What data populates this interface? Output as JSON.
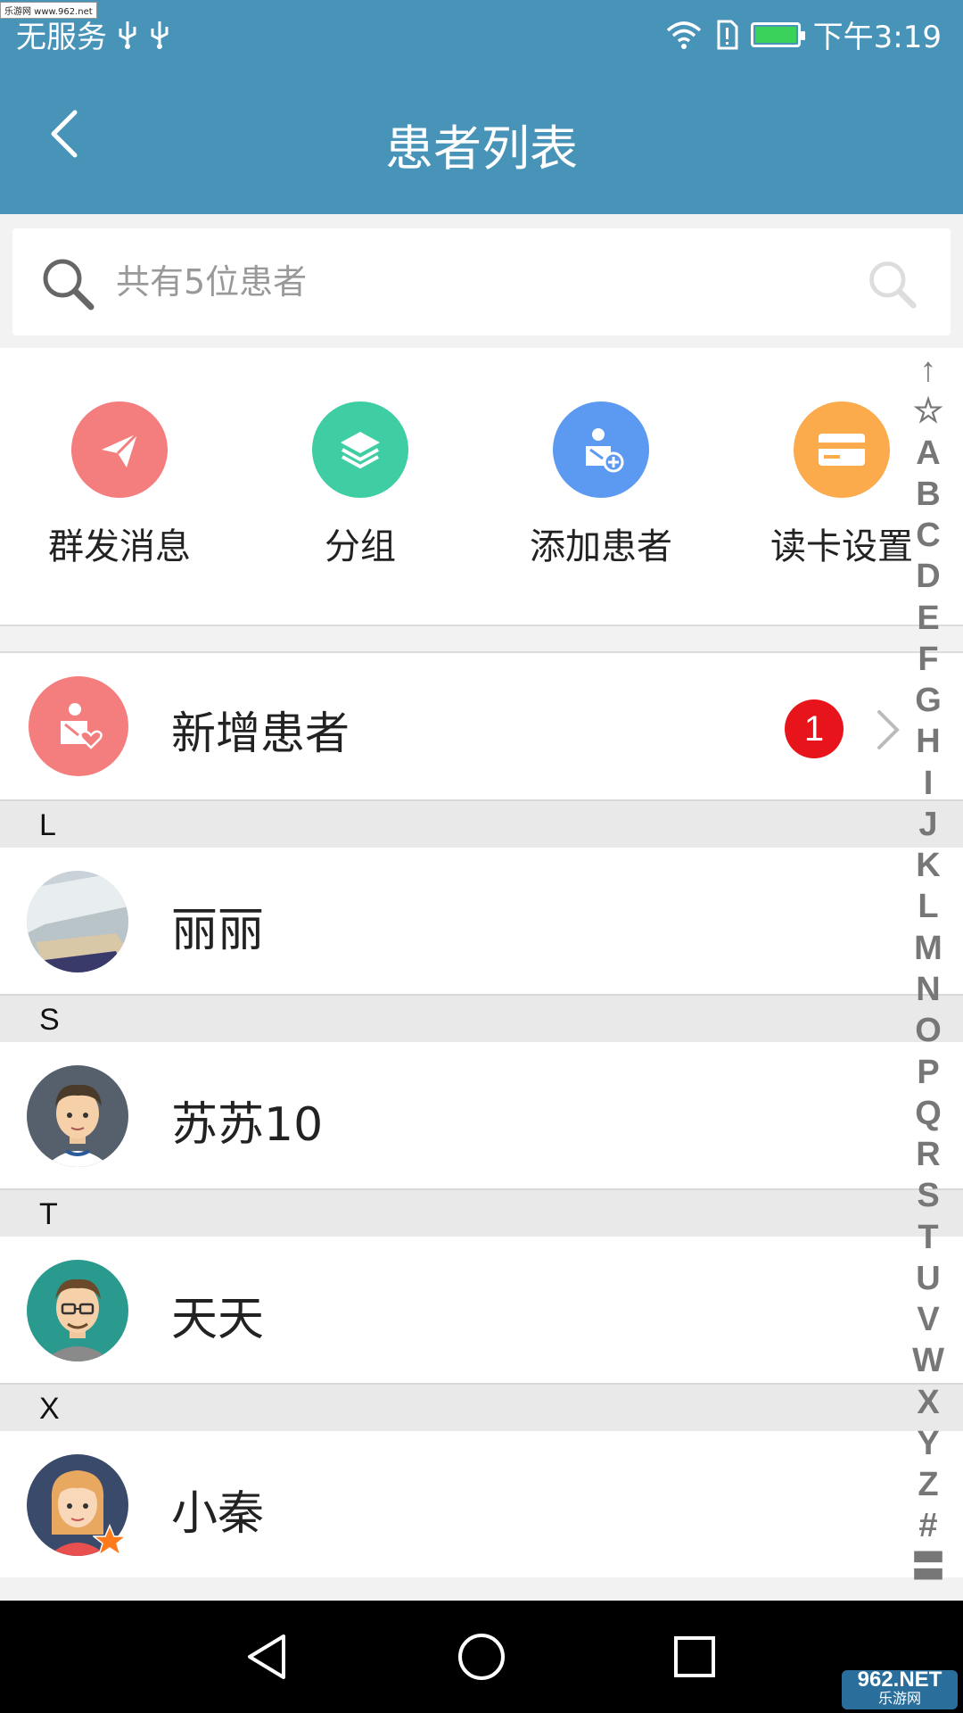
{
  "status_bar": {
    "carrier": "无服务",
    "time": "下午3:19",
    "watermark_top": "乐游网 www.962.net",
    "usb_icon_1": "usb-icon",
    "usb_icon_2": "usb-icon",
    "wifi_icon": "wifi-icon",
    "sim_icon": "sim-alert-icon",
    "battery_icon": "battery-charging-icon"
  },
  "header": {
    "title": "患者列表",
    "back_icon": "chevron-left-icon"
  },
  "search": {
    "placeholder": "共有5位患者"
  },
  "quick_actions": [
    {
      "label": "群发消息",
      "icon": "paper-plane-icon",
      "color": "#f47d7e"
    },
    {
      "label": "分组",
      "icon": "layers-icon",
      "color": "#3fcea3"
    },
    {
      "label": "添加患者",
      "icon": "add-patient-icon",
      "color": "#5b9af0"
    },
    {
      "label": "读卡设置",
      "icon": "card-icon",
      "color": "#fbab4c"
    }
  ],
  "new_patients": {
    "label": "新增患者",
    "badge": "1"
  },
  "sections": [
    {
      "letter": "L",
      "patients": [
        {
          "name": "丽丽",
          "avatar": "photo-avatar"
        }
      ]
    },
    {
      "letter": "S",
      "patients": [
        {
          "name": "苏苏10",
          "avatar": "man-avatar"
        }
      ]
    },
    {
      "letter": "T",
      "patients": [
        {
          "name": "天天",
          "avatar": "man-glasses-avatar"
        }
      ]
    },
    {
      "letter": "X",
      "patients": [
        {
          "name": "小秦",
          "avatar": "woman-avatar"
        }
      ]
    }
  ],
  "index_bar": [
    "↑",
    "☆",
    "A",
    "B",
    "C",
    "D",
    "E",
    "F",
    "G",
    "H",
    "I",
    "J",
    "K",
    "L",
    "M",
    "N",
    "O",
    "P",
    "Q",
    "R",
    "S",
    "T",
    "U",
    "V",
    "W",
    "X",
    "Y",
    "Z",
    "#",
    "〓"
  ],
  "nav": {
    "back": "triangle-back-icon",
    "home": "circle-home-icon",
    "recents": "square-recents-icon"
  },
  "watermark_bottom": {
    "line1": "962.NET",
    "line2": "乐游网"
  },
  "colors": {
    "header_bg": "#4893b8",
    "badge_red": "#e8141b"
  }
}
